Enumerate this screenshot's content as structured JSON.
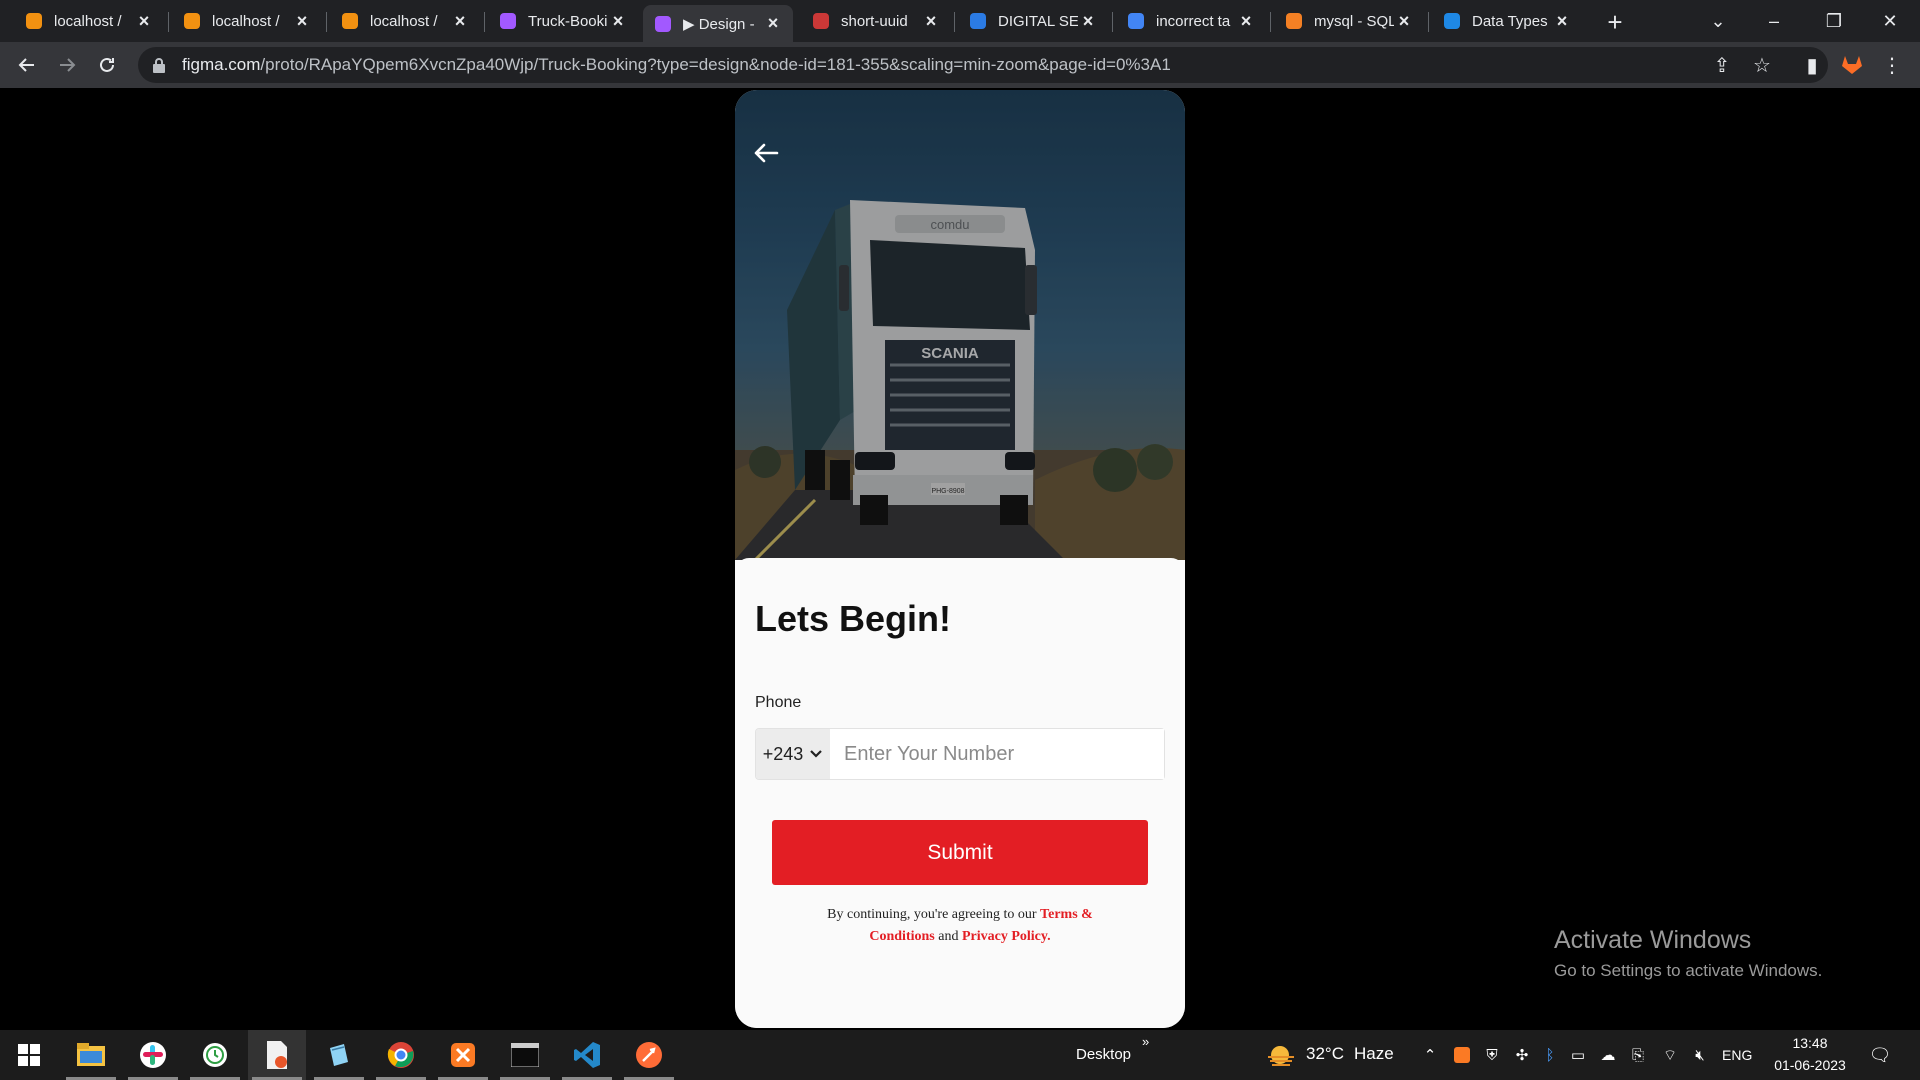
{
  "browser": {
    "tabs": [
      {
        "title": "localhost /",
        "favicon": "phpmyadmin-icon",
        "active": false
      },
      {
        "title": "localhost /",
        "favicon": "phpmyadmin-icon",
        "active": false
      },
      {
        "title": "localhost /",
        "favicon": "phpmyadmin-icon",
        "active": false
      },
      {
        "title": "Truck-Booki",
        "favicon": "figma-icon",
        "active": false
      },
      {
        "title": "▶ Design -",
        "favicon": "figma-icon",
        "active": true
      },
      {
        "title": "short-uuid",
        "favicon": "npm-icon",
        "active": false
      },
      {
        "title": "DIGITAL SEI",
        "favicon": "digitalseo-icon",
        "active": false
      },
      {
        "title": "incorrect ta",
        "favicon": "google-icon",
        "active": false
      },
      {
        "title": "mysql - SQL",
        "favicon": "stackoverflow-icon",
        "active": false
      },
      {
        "title": "Data Types",
        "favicon": "mysql-docs-icon",
        "active": false
      }
    ],
    "url_host": "figma.com",
    "url_path": "/proto/RApaYQpem6XvcnZpa40Wjp/Truck-Booking?type=design&node-id=181-355&scaling=min-zoom&page-id=0%3A1"
  },
  "app": {
    "heading": "Lets Begin!",
    "phone_label": "Phone",
    "country_code": "+243",
    "phone_placeholder": "Enter Your Number",
    "submit_label": "Submit",
    "legal_prefix": "By continuing, you're agreeing to our",
    "legal_terms": "Terms & Conditions",
    "legal_and": "and",
    "legal_privacy": "Privacy Policy.",
    "truck_brand": "SCANIA",
    "truck_logo": "comdu",
    "plate": "PHG-8908"
  },
  "watermark": {
    "title": "Activate Windows",
    "subtitle": "Go to Settings to activate Windows."
  },
  "taskbar": {
    "apps": [
      "windows-start-icon",
      "file-explorer-icon",
      "slack-icon",
      "clock-app-icon",
      "document-app-icon",
      "notepad-icon",
      "chrome-icon",
      "xampp-icon",
      "terminal-icon",
      "vscode-icon",
      "postman-icon"
    ],
    "desktop_label": "Desktop",
    "weather_temp": "32°C",
    "weather_text": "Haze",
    "lang": "ENG",
    "time": "13:48",
    "date": "01-06-2023"
  }
}
